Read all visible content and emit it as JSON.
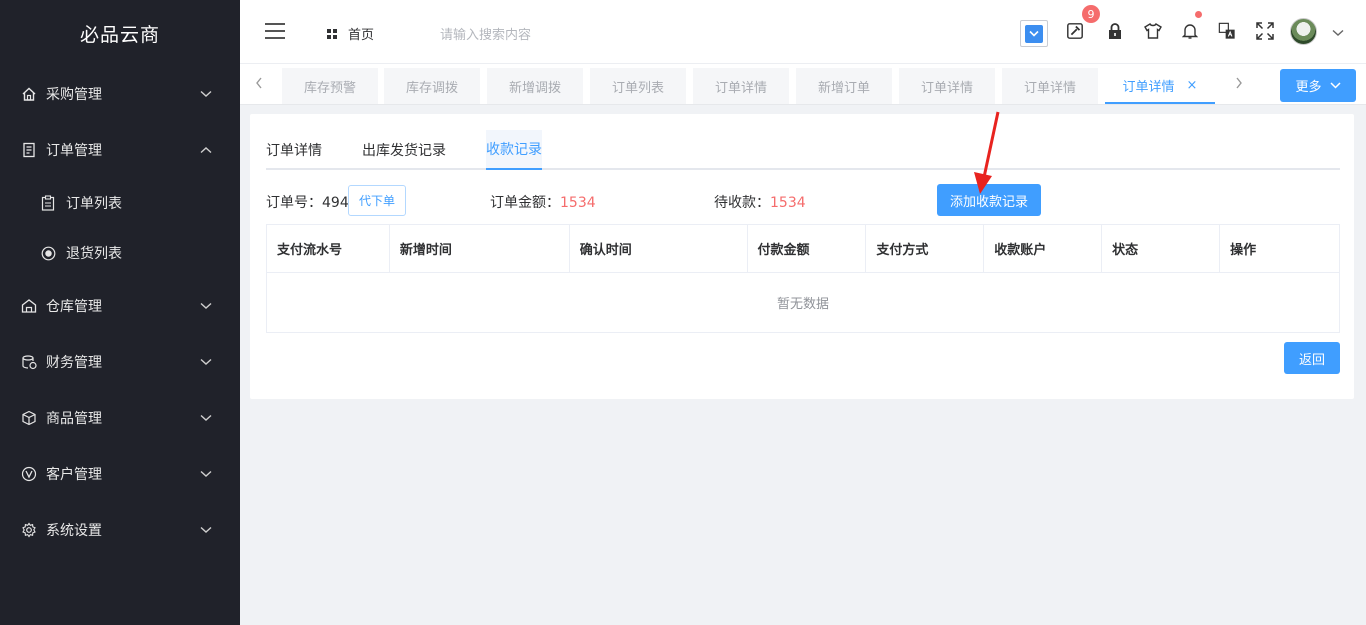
{
  "sidebar": {
    "brand": "必品云商",
    "items": [
      {
        "label": "采购管理",
        "icon": "home-icon",
        "expanded": false
      },
      {
        "label": "订单管理",
        "icon": "document-icon",
        "expanded": true
      },
      {
        "label": "仓库管理",
        "icon": "warehouse-icon",
        "expanded": false
      },
      {
        "label": "财务管理",
        "icon": "finance-icon",
        "expanded": false
      },
      {
        "label": "商品管理",
        "icon": "box-icon",
        "expanded": false
      },
      {
        "label": "客户管理",
        "icon": "customer-icon",
        "expanded": false
      },
      {
        "label": "系统设置",
        "icon": "gear-icon",
        "expanded": false
      }
    ],
    "sub_items": [
      {
        "label": "订单列表",
        "icon": "clipboard-icon"
      },
      {
        "label": "退货列表",
        "icon": "return-icon"
      }
    ]
  },
  "header": {
    "home_label": "首页",
    "search_placeholder": "请输入搜索内容",
    "badge_count": "9"
  },
  "tabs": {
    "items": [
      "库存预警",
      "库存调拨",
      "新增调拨",
      "订单列表",
      "订单详情",
      "新增订单",
      "订单详情",
      "订单详情",
      "订单详情"
    ],
    "active_index": 8,
    "close_glyph": "×",
    "more_label": "更多"
  },
  "detail": {
    "subtabs": [
      "订单详情",
      "出库发货记录",
      "收款记录"
    ],
    "active_subtab": 2,
    "order_no_label": "订单号：",
    "order_no": "494",
    "daixia_label": "代下单",
    "amount_label": "订单金额：",
    "amount": "1534",
    "pending_label": "待收款：",
    "pending": "1534",
    "add_button": "添加收款记录",
    "table": {
      "columns": [
        "支付流水号",
        "新增时间",
        "确认时间",
        "付款金额",
        "支付方式",
        "收款账户",
        "状态",
        "操作"
      ],
      "empty_text": "暂无数据"
    },
    "back_button": "返回"
  },
  "colors": {
    "primary": "#409eff",
    "danger": "#f56c6c",
    "sidebar_bg": "#20222a",
    "annotation": "#e8231f"
  }
}
